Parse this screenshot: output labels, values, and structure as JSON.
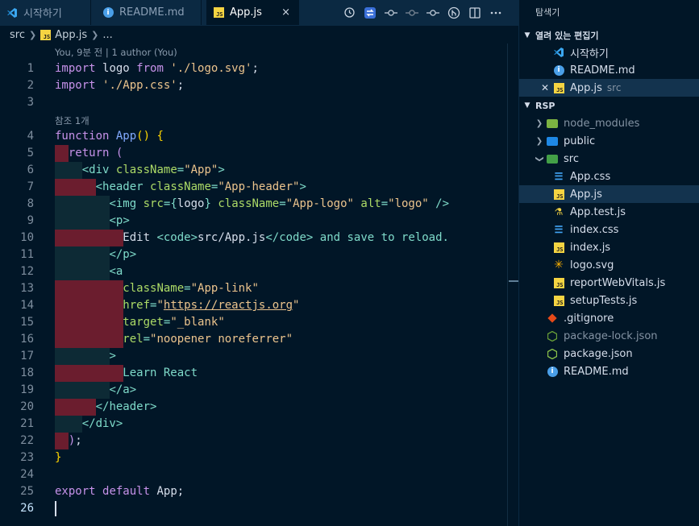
{
  "tabs": [
    {
      "label": "시작하기",
      "icon": "vscode-icon"
    },
    {
      "label": "README.md",
      "icon": "info-icon"
    },
    {
      "label": "App.js",
      "icon": "js-icon",
      "active": true,
      "close": "×"
    }
  ],
  "breadcrumb": {
    "folder": "src",
    "file": "App.js",
    "more": "..."
  },
  "codelens": {
    "blame": "You, 9분 전 | 1 author (You)",
    "refs": "참조 1개"
  },
  "line_numbers": [
    "1",
    "2",
    "3",
    "4",
    "5",
    "6",
    "7",
    "8",
    "9",
    "10",
    "11",
    "12",
    "13",
    "14",
    "15",
    "16",
    "17",
    "18",
    "19",
    "20",
    "21",
    "22",
    "23",
    "24",
    "25",
    "26"
  ],
  "explorer": {
    "title": "탐색기",
    "open_editors_title": "열려 있는 편집기",
    "open_editors": [
      {
        "label": "시작하기"
      },
      {
        "label": "README.md"
      },
      {
        "label": "App.js",
        "desc": "src"
      }
    ],
    "project_title": "RSP",
    "tree": [
      {
        "label": "node_modules"
      },
      {
        "label": "public"
      },
      {
        "label": "src"
      },
      {
        "label": "App.css"
      },
      {
        "label": "App.js"
      },
      {
        "label": "App.test.js"
      },
      {
        "label": "index.css"
      },
      {
        "label": "index.js"
      },
      {
        "label": "logo.svg"
      },
      {
        "label": "reportWebVitals.js"
      },
      {
        "label": "setupTests.js"
      },
      {
        "label": ".gitignore"
      },
      {
        "label": "package-lock.json"
      },
      {
        "label": "package.json"
      },
      {
        "label": "README.md"
      }
    ]
  },
  "colors": {
    "editor_bg": "#011627",
    "keyword": "#c792ea",
    "string": "#ecc48d",
    "tag": "#7fdbca",
    "attribute": "#addb67",
    "function": "#82aaff",
    "error_indent": "#6b1d2e"
  }
}
